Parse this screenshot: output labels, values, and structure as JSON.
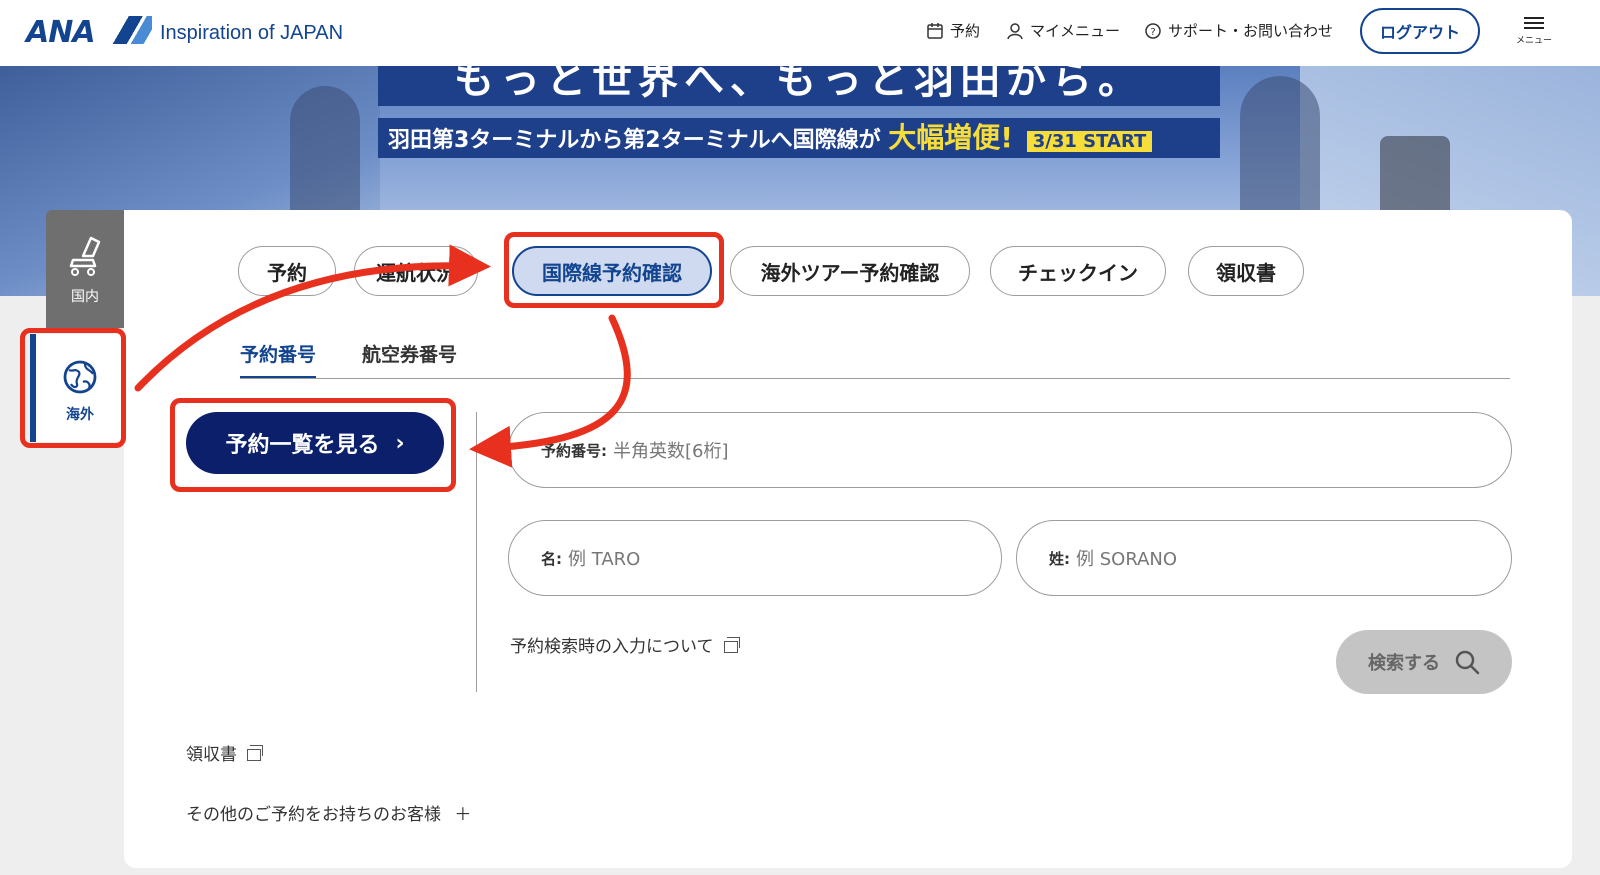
{
  "header": {
    "logo_text": "ANA",
    "tagline": "Inspiration of JAPAN",
    "nav": [
      {
        "label": "予約",
        "icon": "calendar-icon"
      },
      {
        "label": "マイメニュー",
        "icon": "user-icon"
      },
      {
        "label": "サポート・お問い合わせ",
        "icon": "help-icon"
      }
    ],
    "logout_label": "ログアウト",
    "menu_label": "メニュー"
  },
  "banner": {
    "headline": "もっと世界へ、もっと羽田から。",
    "sub_before": "羽田第3ターミナルから第2ターミナルへ国際線が",
    "sub_highlight": "大幅増便!",
    "sub_start": "3/31 START"
  },
  "side_tabs": {
    "domestic": {
      "label": "国内",
      "icon": "seat-icon"
    },
    "international": {
      "label": "海外",
      "icon": "globe-icon"
    }
  },
  "main_tabs": [
    {
      "label": "予約",
      "active": false
    },
    {
      "label": "運航状況",
      "active": false
    },
    {
      "label": "国際線予約確認",
      "active": true
    },
    {
      "label": "海外ツアー予約確認",
      "active": false
    },
    {
      "label": "チェックイン",
      "active": false
    },
    {
      "label": "領収書",
      "active": false
    }
  ],
  "sub_tabs": [
    {
      "label": "予約番号",
      "active": true
    },
    {
      "label": "航空券番号",
      "active": false
    }
  ],
  "view_list_button": "予約一覧を見る",
  "form": {
    "reservation": {
      "label": "予約番号:",
      "placeholder": "半角英数[6桁]"
    },
    "first_name": {
      "label": "名:",
      "placeholder": "例 TARO"
    },
    "last_name": {
      "label": "姓:",
      "placeholder": "例 SORANO"
    },
    "help_link": "予約検索時の入力について",
    "search_button": "検索する"
  },
  "links": {
    "receipt": "領収書",
    "others": "その他のご予約をお持ちのお客様"
  },
  "colors": {
    "brand": "#13448f",
    "primary_button": "#0c1f6b",
    "annotation": "#e8301e"
  }
}
